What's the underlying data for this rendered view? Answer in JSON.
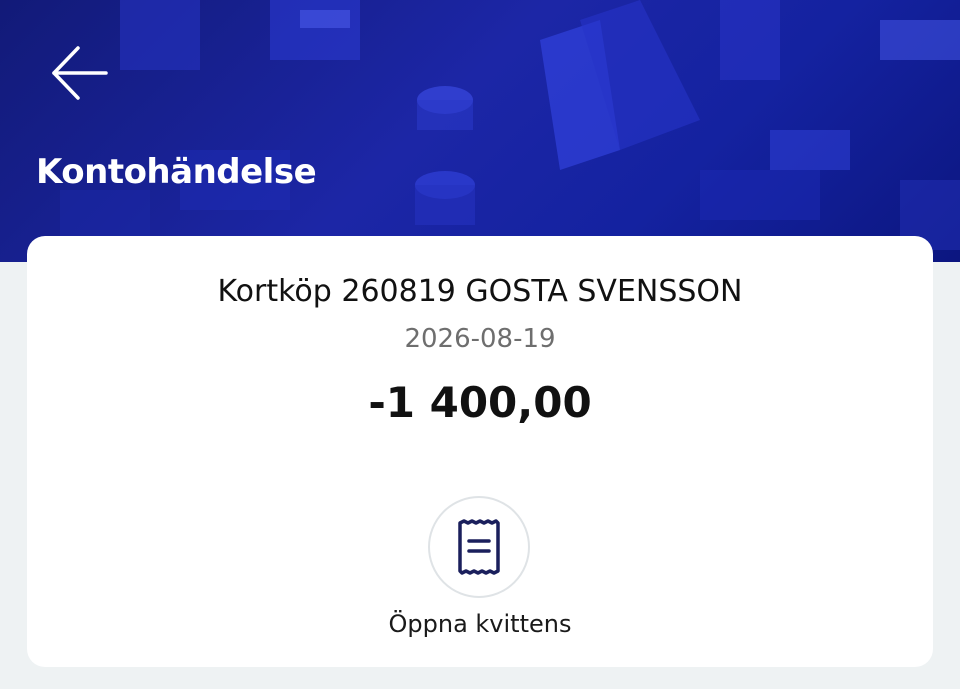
{
  "header": {
    "title": "Kontohändelse",
    "back_icon": "arrow-left-icon",
    "background_color": "#1c26a6"
  },
  "transaction": {
    "description": "Kortköp 260819 GOSTA SVENSSON",
    "date": "2026-08-19",
    "amount": "-1 400,00"
  },
  "actions": {
    "receipt_icon": "receipt-icon",
    "receipt_label": "Öppna kvittens"
  }
}
